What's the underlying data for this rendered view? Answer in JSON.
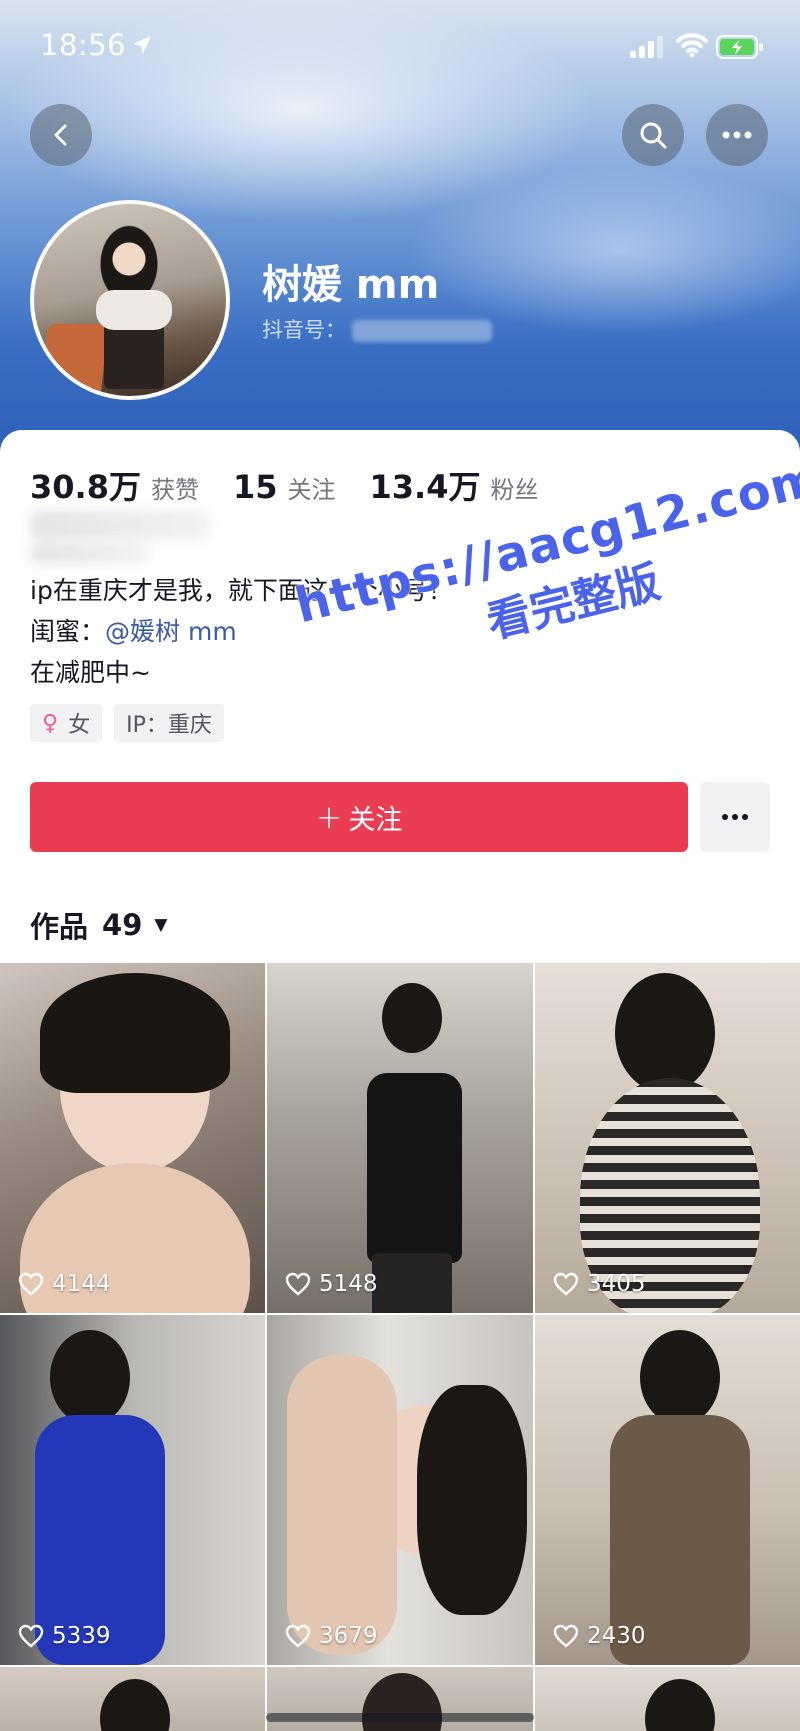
{
  "status_bar": {
    "time": "18:56"
  },
  "profile": {
    "name": "树媛 mm",
    "douyin_id_label": "抖音号："
  },
  "stats": [
    {
      "value": "30.8万",
      "label": "获赞"
    },
    {
      "value": "15",
      "label": "关注"
    },
    {
      "value": "13.4万",
      "label": "粉丝"
    }
  ],
  "bio": {
    "line1": "ip在重庆才是我，就下面这一个小号！",
    "line2_prefix": "闺蜜：",
    "line2_mention": "@媛树 mm",
    "line3": "在减肥中~"
  },
  "tags": {
    "gender_icon": "♀",
    "gender": "女",
    "ip": "IP：重庆"
  },
  "actions": {
    "follow_plus": "+",
    "follow_label": "关注"
  },
  "works": {
    "label": "作品",
    "count": "49",
    "caret": "▼"
  },
  "watermark": {
    "url": "https://aacg12.com",
    "text": "看完整版"
  },
  "videos": [
    {
      "likes": "4144"
    },
    {
      "likes": "5148"
    },
    {
      "likes": "3405"
    },
    {
      "likes": "5339"
    },
    {
      "likes": "3679"
    },
    {
      "likes": "2430"
    }
  ],
  "colors": {
    "follow_button": "#ea3d54",
    "mention": "#3b5aa8",
    "gender_icon": "#f05b9c",
    "watermark": "#4a63e8"
  }
}
